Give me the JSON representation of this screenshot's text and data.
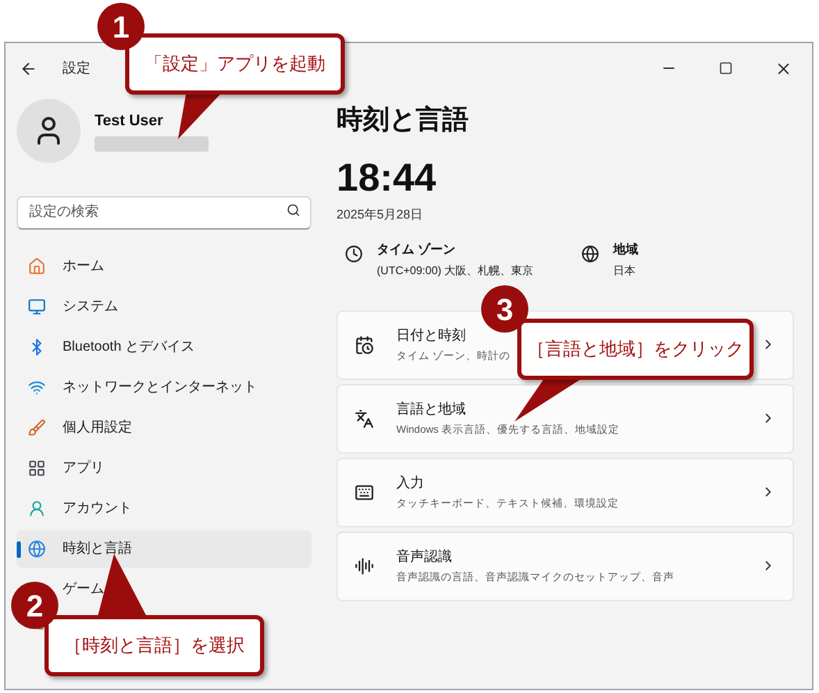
{
  "window": {
    "title": "設定"
  },
  "user": {
    "name": "Test User"
  },
  "search": {
    "placeholder": "設定の検索"
  },
  "sidebar": {
    "items": [
      {
        "label": "ホーム",
        "selected": false,
        "kind": "home"
      },
      {
        "label": "システム",
        "selected": false,
        "kind": "system"
      },
      {
        "label": "Bluetooth とデバイス",
        "selected": false,
        "kind": "bluetooth"
      },
      {
        "label": "ネットワークとインターネット",
        "selected": false,
        "kind": "network"
      },
      {
        "label": "個人用設定",
        "selected": false,
        "kind": "personal"
      },
      {
        "label": "アプリ",
        "selected": false,
        "kind": "apps"
      },
      {
        "label": "アカウント",
        "selected": false,
        "kind": "account"
      },
      {
        "label": "時刻と言語",
        "selected": true,
        "kind": "time"
      },
      {
        "label": "ゲーム",
        "selected": false,
        "kind": "game"
      }
    ]
  },
  "page": {
    "title": "時刻と言語",
    "time": "18:44",
    "date": "2025年5月28日",
    "info": [
      {
        "kind": "timezone",
        "title": "タイム ゾーン",
        "value": "(UTC+09:00) 大阪、札幌、東京"
      },
      {
        "kind": "region",
        "title": "地域",
        "value": "日本"
      }
    ],
    "cards": [
      {
        "kind": "datetime",
        "title": "日付と時刻",
        "subtitle": "タイム ゾーン、時計の"
      },
      {
        "kind": "language",
        "title": "言語と地域",
        "subtitle": "Windows 表示言語、優先する言語、地域設定"
      },
      {
        "kind": "input",
        "title": "入力",
        "subtitle": "タッチキーボード、テキスト候補、環境設定"
      },
      {
        "kind": "speech",
        "title": "音声認識",
        "subtitle": "音声認識の言語、音声認識マイクのセットアップ、音声"
      }
    ]
  },
  "callouts": [
    {
      "number": "1",
      "text": "「設定」アプリを起動"
    },
    {
      "number": "2",
      "text": "［時刻と言語］を選択"
    },
    {
      "number": "3",
      "text": "［言語と地域］をクリック"
    }
  ]
}
